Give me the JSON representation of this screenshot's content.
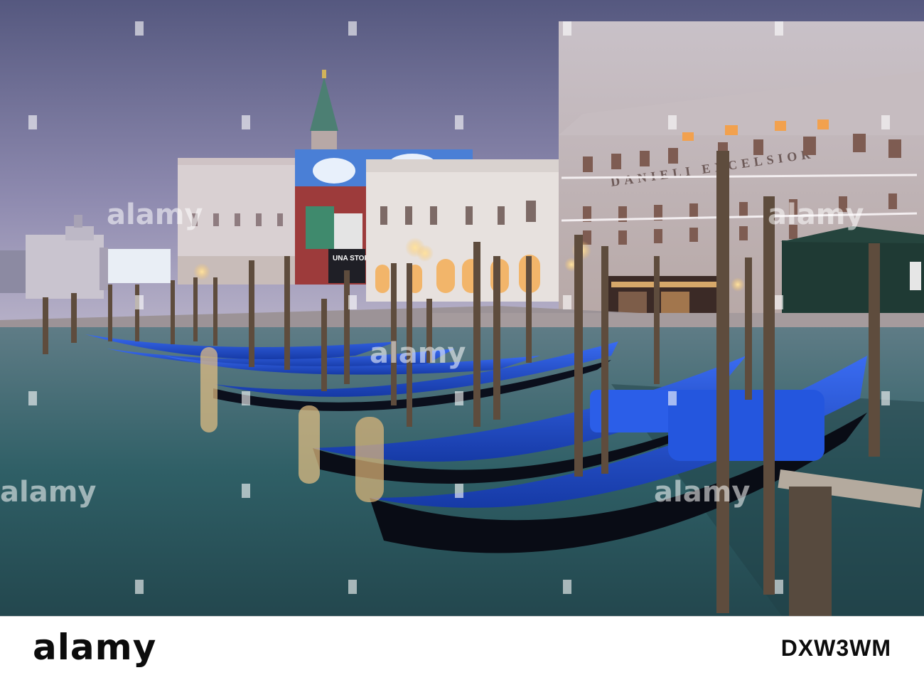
{
  "scene": {
    "description_colors": {
      "sky_top": "#5b5e86",
      "sky_bottom": "#b9b3c9",
      "water": "#2f5f66",
      "gondola_cover": "#1f4fd6",
      "lamp_glow": "#f7c46a"
    }
  },
  "photo_text": {
    "billboard": "UNA STORIA IT",
    "hotel_sign": "DANIELI EXCELSIOR"
  },
  "watermark": {
    "text": "alamy"
  },
  "footer": {
    "brand": "alamy",
    "stock_id": "DXW3WM"
  }
}
